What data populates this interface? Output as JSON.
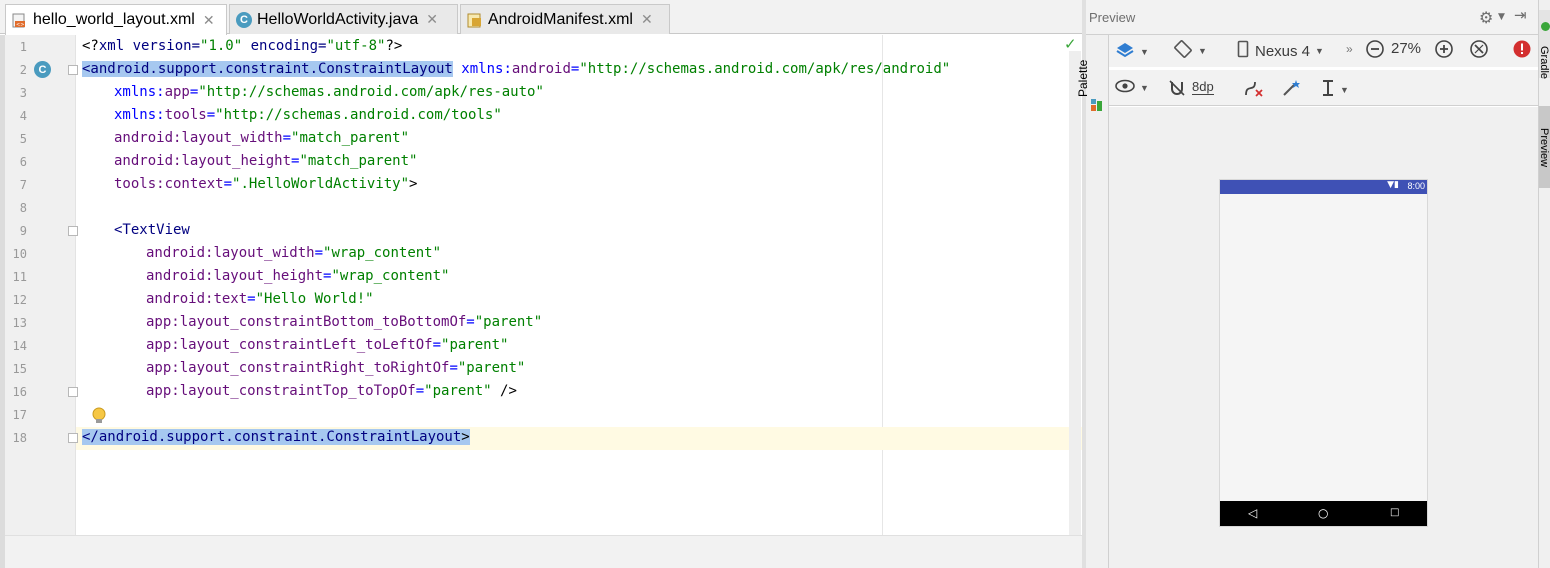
{
  "tabs": [
    {
      "label": "hello_world_layout.xml",
      "icon": "xml-layout-icon",
      "active": true
    },
    {
      "label": "HelloWorldActivity.java",
      "icon": "java-class-icon",
      "active": false
    },
    {
      "label": "AndroidManifest.xml",
      "icon": "manifest-icon",
      "active": false
    }
  ],
  "editor": {
    "line_numbers": [
      "1",
      "2",
      "3",
      "4",
      "5",
      "6",
      "7",
      "8",
      "9",
      "10",
      "11",
      "12",
      "13",
      "14",
      "15",
      "16",
      "17",
      "18"
    ],
    "gutter_badge": "C",
    "lines": {
      "l1": {
        "a": "<?",
        "b": "xml version=",
        "c": "\"1.0\"",
        "d": " encoding=",
        "e": "\"utf-8\"",
        "f": "?>"
      },
      "l2": {
        "tag": "<android.support.constraint.ConstraintLayout",
        "ns": " xmlns:",
        "attr": "android",
        "eq": "=",
        "val": "\"http://schemas.android.com/apk/res/android\""
      },
      "l3": {
        "ns": "xmlns:",
        "attr": "app",
        "eq": "=",
        "val": "\"http://schemas.android.com/apk/res-auto\""
      },
      "l4": {
        "ns": "xmlns:",
        "attr": "tools",
        "eq": "=",
        "val": "\"http://schemas.android.com/tools\""
      },
      "l5": {
        "ns": "android:",
        "attr": "layout_width",
        "eq": "=",
        "val": "\"match_parent\""
      },
      "l6": {
        "ns": "android:",
        "attr": "layout_height",
        "eq": "=",
        "val": "\"match_parent\""
      },
      "l7": {
        "ns": "tools:",
        "attr": "context",
        "eq": "=",
        "val": "\".HelloWorldActivity\"",
        "end": ">"
      },
      "l9": {
        "tag": "<TextView"
      },
      "l10": {
        "ns": "android:",
        "attr": "layout_width",
        "eq": "=",
        "val": "\"wrap_content\""
      },
      "l11": {
        "ns": "android:",
        "attr": "layout_height",
        "eq": "=",
        "val": "\"wrap_content\""
      },
      "l12": {
        "ns": "android:",
        "attr": "text",
        "eq": "=",
        "val": "\"Hello World!\""
      },
      "l13": {
        "ns": "app:",
        "attr": "layout_constraintBottom_toBottomOf",
        "eq": "=",
        "val": "\"parent\""
      },
      "l14": {
        "ns": "app:",
        "attr": "layout_constraintLeft_toLeftOf",
        "eq": "=",
        "val": "\"parent\""
      },
      "l15": {
        "ns": "app:",
        "attr": "layout_constraintRight_toRightOf",
        "eq": "=",
        "val": "\"parent\""
      },
      "l16": {
        "ns": "app:",
        "attr": "layout_constraintTop_toTopOf",
        "eq": "=",
        "val": "\"parent\"",
        "end": " />"
      },
      "l18": {
        "tag": "</android.support.constraint.ConstraintLayout",
        "end": ">"
      }
    }
  },
  "preview": {
    "title": "Preview",
    "palette_label": "Palette",
    "device": "Nexus 4",
    "zoom": "27%",
    "margin": "8dp",
    "status_time": "8:00"
  },
  "side_tabs": {
    "gradle": "Gradle",
    "preview": "Preview"
  },
  "colors": {
    "status_bar": "#3f51b5",
    "selection": "#a6c8f0",
    "caret_line": "#fffae3",
    "error": "#d32f2f"
  }
}
